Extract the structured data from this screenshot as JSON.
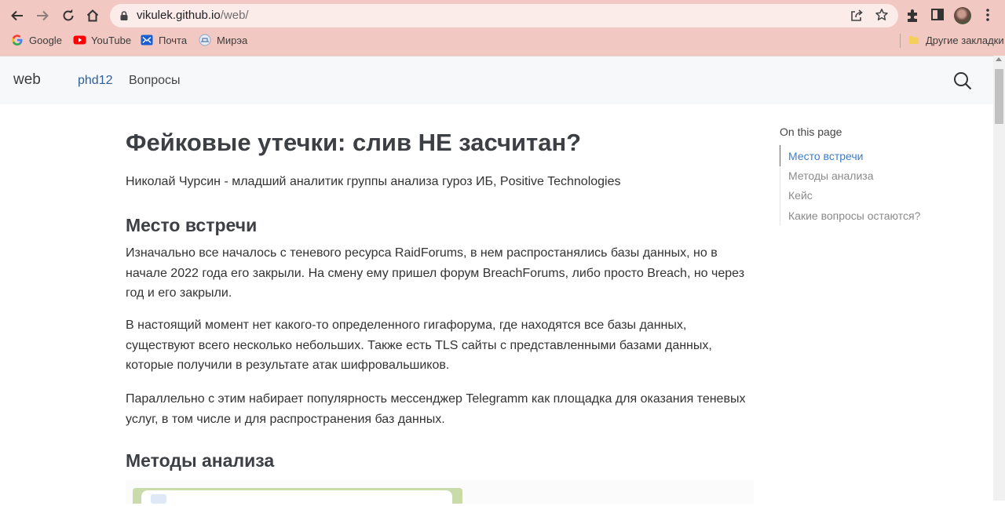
{
  "browser": {
    "url_host": "vikulek.github.io",
    "url_path": "/web/",
    "bookmarks": [
      {
        "label": "Google",
        "icon": "google-icon"
      },
      {
        "label": "YouTube",
        "icon": "youtube-icon"
      },
      {
        "label": "Почта",
        "icon": "mail-icon"
      },
      {
        "label": "Мирэа",
        "icon": "mirea-icon"
      }
    ],
    "other_bookmarks": "Другие закладки",
    "colors": {
      "chrome": "#f2c9c2",
      "omnibox": "#fbecea"
    }
  },
  "site": {
    "brand": "web",
    "nav": [
      {
        "label": "phd12",
        "active": true
      },
      {
        "label": "Вопросы",
        "active": false
      }
    ],
    "accent": "#3d7cc9"
  },
  "article": {
    "title": "Фейковые утечки: слив НЕ засчитан?",
    "subtitle": "Николай Чурсин - младший аналитик группы анализа гуроз ИБ, Positive Technologies",
    "section1_heading": "Место встречи",
    "paragraphs": [
      "Изначально все началось с теневого ресурса RaidForums, в нем распростанялись базы данных, но в начале 2022 года его закрыли. На смену ему пришел форум BreachForums, либо просто Breach, но через год и его закрыли.",
      "В настоящий момент нет какого-то определенного гигафорума, где находятся все базы данных, существуют всего несколько небольших. Также есть TLS сайты с представленными базами данных, которые получили в результате атак шифровальшиков.",
      "Параллельно с этим набирает популярность мессенджер Telegramm как площадка для оказания теневых услуг, в том числе и для распространения баз данных."
    ],
    "section2_heading": "Методы анализа"
  },
  "toc": {
    "title": "On this page",
    "items": [
      {
        "label": "Место встречи",
        "active": true
      },
      {
        "label": "Методы анализа",
        "active": false
      },
      {
        "label": "Кейс",
        "active": false
      },
      {
        "label": "Какие вопросы остаются?",
        "active": false
      }
    ]
  }
}
